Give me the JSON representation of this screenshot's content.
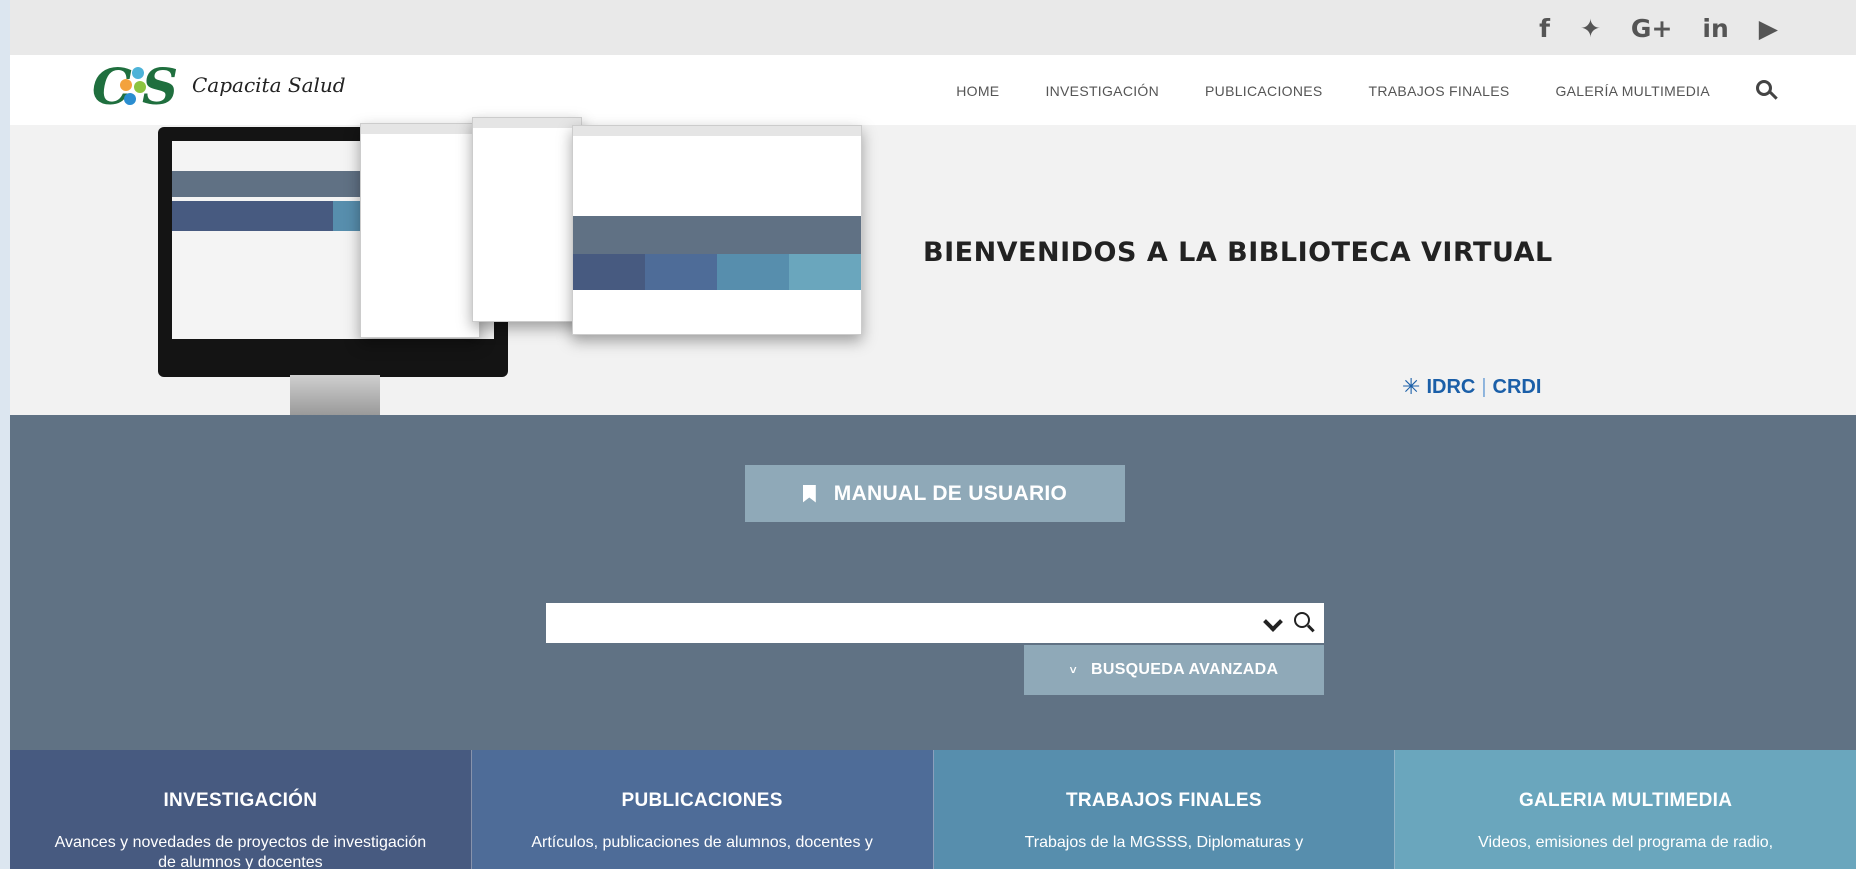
{
  "social": {
    "items": [
      {
        "label": "f",
        "icon": "facebook-icon"
      },
      {
        "label": "✦",
        "icon": "twitter-icon"
      },
      {
        "label": "G+",
        "icon": "google-plus-icon"
      },
      {
        "label": "in",
        "icon": "linkedin-icon"
      },
      {
        "label": "▶",
        "icon": "youtube-icon"
      }
    ]
  },
  "nav": {
    "logo_text": "Capacita Salud",
    "items": [
      {
        "label": "HOME"
      },
      {
        "label": "INVESTIGACIÓN"
      },
      {
        "label": "PUBLICACIONES"
      },
      {
        "label": "TRABAJOS FINALES"
      },
      {
        "label": "GALERÍA MULTIMEDIA"
      }
    ]
  },
  "hero": {
    "title": "BIENVENIDOS A LA BIBLIOTECA VIRTUAL",
    "partner_left": "IDRC",
    "partner_right": "CRDI",
    "partner_sep": "|"
  },
  "search": {
    "manual_label": "MANUAL DE USUARIO",
    "input_value": "",
    "input_placeholder": "",
    "advanced_label": "BUSQUEDA AVANZADA"
  },
  "categories": [
    {
      "title": "INVESTIGACIÓN",
      "desc": "Avances y novedades de proyectos de investigación de alumnos y docentes",
      "color": "#475a80"
    },
    {
      "title": "PUBLICACIONES",
      "desc": "Artículos, publicaciones de alumnos, docentes y",
      "color": "#4e6c98"
    },
    {
      "title": "TRABAJOS FINALES",
      "desc": "Trabajos de la MGSSS, Diplomaturas y",
      "color": "#578ead"
    },
    {
      "title": "GALERIA MULTIMEDIA",
      "desc": "Videos, emisiones del programa de radio,",
      "color": "#6aa6bd"
    }
  ],
  "colors": {
    "brand_green": "#1f6f3e",
    "search_section_bg": "#607284",
    "button_bg": "#8fa9b8",
    "idrc_blue": "#1b5fa8"
  }
}
